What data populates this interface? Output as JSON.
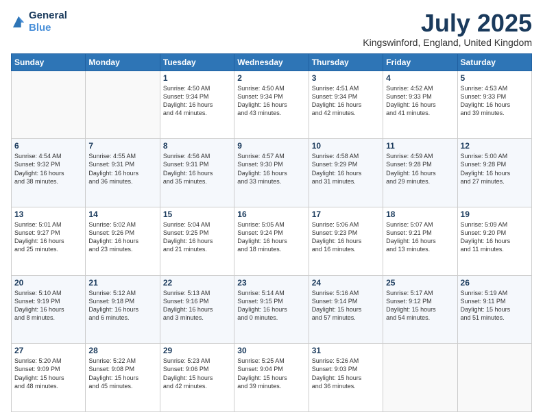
{
  "header": {
    "logo_line1": "General",
    "logo_line2": "Blue",
    "title": "July 2025",
    "subtitle": "Kingswinford, England, United Kingdom"
  },
  "days_of_week": [
    "Sunday",
    "Monday",
    "Tuesday",
    "Wednesday",
    "Thursday",
    "Friday",
    "Saturday"
  ],
  "weeks": [
    [
      {
        "num": "",
        "info": ""
      },
      {
        "num": "",
        "info": ""
      },
      {
        "num": "1",
        "info": "Sunrise: 4:50 AM\nSunset: 9:34 PM\nDaylight: 16 hours\nand 44 minutes."
      },
      {
        "num": "2",
        "info": "Sunrise: 4:50 AM\nSunset: 9:34 PM\nDaylight: 16 hours\nand 43 minutes."
      },
      {
        "num": "3",
        "info": "Sunrise: 4:51 AM\nSunset: 9:34 PM\nDaylight: 16 hours\nand 42 minutes."
      },
      {
        "num": "4",
        "info": "Sunrise: 4:52 AM\nSunset: 9:33 PM\nDaylight: 16 hours\nand 41 minutes."
      },
      {
        "num": "5",
        "info": "Sunrise: 4:53 AM\nSunset: 9:33 PM\nDaylight: 16 hours\nand 39 minutes."
      }
    ],
    [
      {
        "num": "6",
        "info": "Sunrise: 4:54 AM\nSunset: 9:32 PM\nDaylight: 16 hours\nand 38 minutes."
      },
      {
        "num": "7",
        "info": "Sunrise: 4:55 AM\nSunset: 9:31 PM\nDaylight: 16 hours\nand 36 minutes."
      },
      {
        "num": "8",
        "info": "Sunrise: 4:56 AM\nSunset: 9:31 PM\nDaylight: 16 hours\nand 35 minutes."
      },
      {
        "num": "9",
        "info": "Sunrise: 4:57 AM\nSunset: 9:30 PM\nDaylight: 16 hours\nand 33 minutes."
      },
      {
        "num": "10",
        "info": "Sunrise: 4:58 AM\nSunset: 9:29 PM\nDaylight: 16 hours\nand 31 minutes."
      },
      {
        "num": "11",
        "info": "Sunrise: 4:59 AM\nSunset: 9:28 PM\nDaylight: 16 hours\nand 29 minutes."
      },
      {
        "num": "12",
        "info": "Sunrise: 5:00 AM\nSunset: 9:28 PM\nDaylight: 16 hours\nand 27 minutes."
      }
    ],
    [
      {
        "num": "13",
        "info": "Sunrise: 5:01 AM\nSunset: 9:27 PM\nDaylight: 16 hours\nand 25 minutes."
      },
      {
        "num": "14",
        "info": "Sunrise: 5:02 AM\nSunset: 9:26 PM\nDaylight: 16 hours\nand 23 minutes."
      },
      {
        "num": "15",
        "info": "Sunrise: 5:04 AM\nSunset: 9:25 PM\nDaylight: 16 hours\nand 21 minutes."
      },
      {
        "num": "16",
        "info": "Sunrise: 5:05 AM\nSunset: 9:24 PM\nDaylight: 16 hours\nand 18 minutes."
      },
      {
        "num": "17",
        "info": "Sunrise: 5:06 AM\nSunset: 9:23 PM\nDaylight: 16 hours\nand 16 minutes."
      },
      {
        "num": "18",
        "info": "Sunrise: 5:07 AM\nSunset: 9:21 PM\nDaylight: 16 hours\nand 13 minutes."
      },
      {
        "num": "19",
        "info": "Sunrise: 5:09 AM\nSunset: 9:20 PM\nDaylight: 16 hours\nand 11 minutes."
      }
    ],
    [
      {
        "num": "20",
        "info": "Sunrise: 5:10 AM\nSunset: 9:19 PM\nDaylight: 16 hours\nand 8 minutes."
      },
      {
        "num": "21",
        "info": "Sunrise: 5:12 AM\nSunset: 9:18 PM\nDaylight: 16 hours\nand 6 minutes."
      },
      {
        "num": "22",
        "info": "Sunrise: 5:13 AM\nSunset: 9:16 PM\nDaylight: 16 hours\nand 3 minutes."
      },
      {
        "num": "23",
        "info": "Sunrise: 5:14 AM\nSunset: 9:15 PM\nDaylight: 16 hours\nand 0 minutes."
      },
      {
        "num": "24",
        "info": "Sunrise: 5:16 AM\nSunset: 9:14 PM\nDaylight: 15 hours\nand 57 minutes."
      },
      {
        "num": "25",
        "info": "Sunrise: 5:17 AM\nSunset: 9:12 PM\nDaylight: 15 hours\nand 54 minutes."
      },
      {
        "num": "26",
        "info": "Sunrise: 5:19 AM\nSunset: 9:11 PM\nDaylight: 15 hours\nand 51 minutes."
      }
    ],
    [
      {
        "num": "27",
        "info": "Sunrise: 5:20 AM\nSunset: 9:09 PM\nDaylight: 15 hours\nand 48 minutes."
      },
      {
        "num": "28",
        "info": "Sunrise: 5:22 AM\nSunset: 9:08 PM\nDaylight: 15 hours\nand 45 minutes."
      },
      {
        "num": "29",
        "info": "Sunrise: 5:23 AM\nSunset: 9:06 PM\nDaylight: 15 hours\nand 42 minutes."
      },
      {
        "num": "30",
        "info": "Sunrise: 5:25 AM\nSunset: 9:04 PM\nDaylight: 15 hours\nand 39 minutes."
      },
      {
        "num": "31",
        "info": "Sunrise: 5:26 AM\nSunset: 9:03 PM\nDaylight: 15 hours\nand 36 minutes."
      },
      {
        "num": "",
        "info": ""
      },
      {
        "num": "",
        "info": ""
      }
    ]
  ]
}
